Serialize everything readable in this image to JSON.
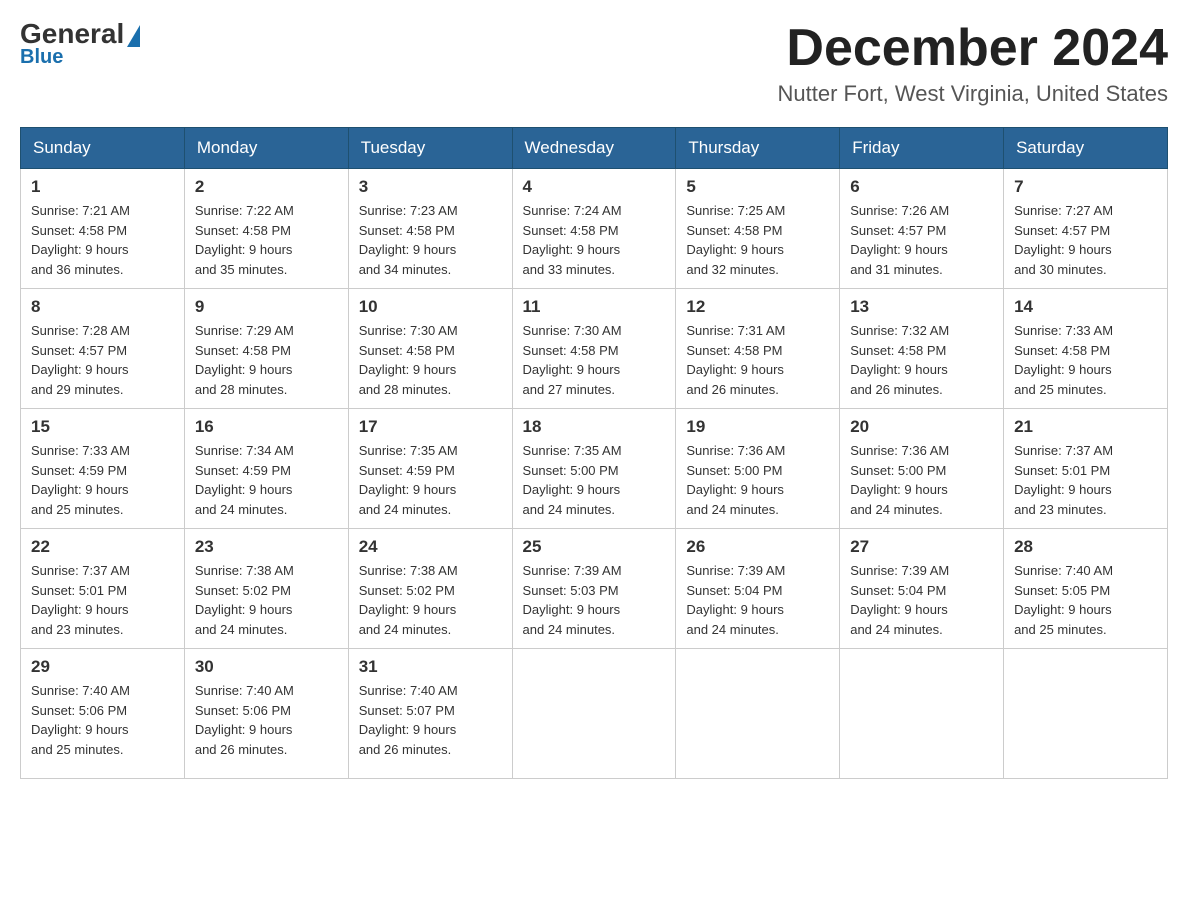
{
  "logo": {
    "general": "General",
    "blue": "Blue",
    "triangle_indicator": "▲"
  },
  "title": "December 2024",
  "location": "Nutter Fort, West Virginia, United States",
  "days_of_week": [
    "Sunday",
    "Monday",
    "Tuesday",
    "Wednesday",
    "Thursday",
    "Friday",
    "Saturday"
  ],
  "weeks": [
    [
      {
        "day": "1",
        "sunrise": "7:21 AM",
        "sunset": "4:58 PM",
        "daylight": "9 hours and 36 minutes."
      },
      {
        "day": "2",
        "sunrise": "7:22 AM",
        "sunset": "4:58 PM",
        "daylight": "9 hours and 35 minutes."
      },
      {
        "day": "3",
        "sunrise": "7:23 AM",
        "sunset": "4:58 PM",
        "daylight": "9 hours and 34 minutes."
      },
      {
        "day": "4",
        "sunrise": "7:24 AM",
        "sunset": "4:58 PM",
        "daylight": "9 hours and 33 minutes."
      },
      {
        "day": "5",
        "sunrise": "7:25 AM",
        "sunset": "4:58 PM",
        "daylight": "9 hours and 32 minutes."
      },
      {
        "day": "6",
        "sunrise": "7:26 AM",
        "sunset": "4:57 PM",
        "daylight": "9 hours and 31 minutes."
      },
      {
        "day": "7",
        "sunrise": "7:27 AM",
        "sunset": "4:57 PM",
        "daylight": "9 hours and 30 minutes."
      }
    ],
    [
      {
        "day": "8",
        "sunrise": "7:28 AM",
        "sunset": "4:57 PM",
        "daylight": "9 hours and 29 minutes."
      },
      {
        "day": "9",
        "sunrise": "7:29 AM",
        "sunset": "4:58 PM",
        "daylight": "9 hours and 28 minutes."
      },
      {
        "day": "10",
        "sunrise": "7:30 AM",
        "sunset": "4:58 PM",
        "daylight": "9 hours and 28 minutes."
      },
      {
        "day": "11",
        "sunrise": "7:30 AM",
        "sunset": "4:58 PM",
        "daylight": "9 hours and 27 minutes."
      },
      {
        "day": "12",
        "sunrise": "7:31 AM",
        "sunset": "4:58 PM",
        "daylight": "9 hours and 26 minutes."
      },
      {
        "day": "13",
        "sunrise": "7:32 AM",
        "sunset": "4:58 PM",
        "daylight": "9 hours and 26 minutes."
      },
      {
        "day": "14",
        "sunrise": "7:33 AM",
        "sunset": "4:58 PM",
        "daylight": "9 hours and 25 minutes."
      }
    ],
    [
      {
        "day": "15",
        "sunrise": "7:33 AM",
        "sunset": "4:59 PM",
        "daylight": "9 hours and 25 minutes."
      },
      {
        "day": "16",
        "sunrise": "7:34 AM",
        "sunset": "4:59 PM",
        "daylight": "9 hours and 24 minutes."
      },
      {
        "day": "17",
        "sunrise": "7:35 AM",
        "sunset": "4:59 PM",
        "daylight": "9 hours and 24 minutes."
      },
      {
        "day": "18",
        "sunrise": "7:35 AM",
        "sunset": "5:00 PM",
        "daylight": "9 hours and 24 minutes."
      },
      {
        "day": "19",
        "sunrise": "7:36 AM",
        "sunset": "5:00 PM",
        "daylight": "9 hours and 24 minutes."
      },
      {
        "day": "20",
        "sunrise": "7:36 AM",
        "sunset": "5:00 PM",
        "daylight": "9 hours and 24 minutes."
      },
      {
        "day": "21",
        "sunrise": "7:37 AM",
        "sunset": "5:01 PM",
        "daylight": "9 hours and 23 minutes."
      }
    ],
    [
      {
        "day": "22",
        "sunrise": "7:37 AM",
        "sunset": "5:01 PM",
        "daylight": "9 hours and 23 minutes."
      },
      {
        "day": "23",
        "sunrise": "7:38 AM",
        "sunset": "5:02 PM",
        "daylight": "9 hours and 24 minutes."
      },
      {
        "day": "24",
        "sunrise": "7:38 AM",
        "sunset": "5:02 PM",
        "daylight": "9 hours and 24 minutes."
      },
      {
        "day": "25",
        "sunrise": "7:39 AM",
        "sunset": "5:03 PM",
        "daylight": "9 hours and 24 minutes."
      },
      {
        "day": "26",
        "sunrise": "7:39 AM",
        "sunset": "5:04 PM",
        "daylight": "9 hours and 24 minutes."
      },
      {
        "day": "27",
        "sunrise": "7:39 AM",
        "sunset": "5:04 PM",
        "daylight": "9 hours and 24 minutes."
      },
      {
        "day": "28",
        "sunrise": "7:40 AM",
        "sunset": "5:05 PM",
        "daylight": "9 hours and 25 minutes."
      }
    ],
    [
      {
        "day": "29",
        "sunrise": "7:40 AM",
        "sunset": "5:06 PM",
        "daylight": "9 hours and 25 minutes."
      },
      {
        "day": "30",
        "sunrise": "7:40 AM",
        "sunset": "5:06 PM",
        "daylight": "9 hours and 26 minutes."
      },
      {
        "day": "31",
        "sunrise": "7:40 AM",
        "sunset": "5:07 PM",
        "daylight": "9 hours and 26 minutes."
      },
      null,
      null,
      null,
      null
    ]
  ]
}
